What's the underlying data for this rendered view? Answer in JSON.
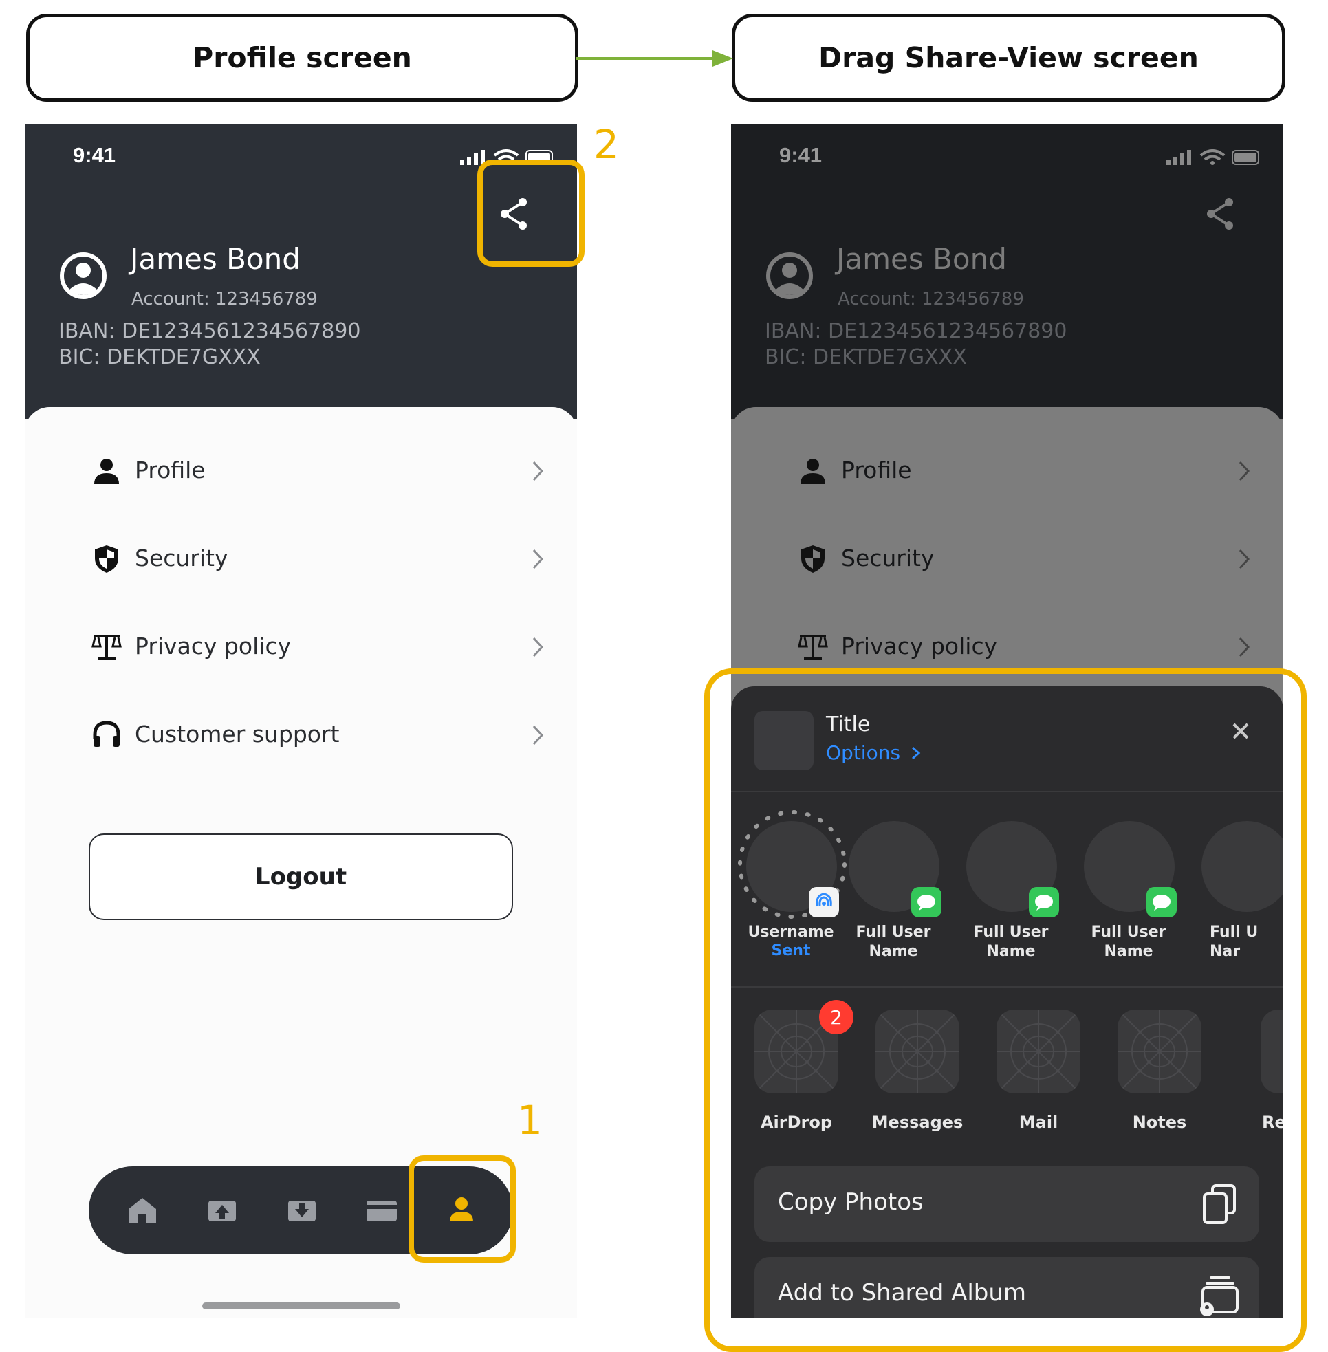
{
  "captions": {
    "left": "Profile screen",
    "right": "Drag Share-View screen"
  },
  "steps": {
    "one": "1",
    "two": "2"
  },
  "status": {
    "time": "9:41"
  },
  "user": {
    "name": "James Bond",
    "account": "Account: 123456789",
    "iban": "IBAN: DE1234561234567890",
    "bic": "BIC: DEKTDE7GXXX"
  },
  "menu": [
    {
      "label": "Profile",
      "icon": "person-icon"
    },
    {
      "label": "Security",
      "icon": "shield-icon"
    },
    {
      "label": "Privacy policy",
      "icon": "scales-icon"
    },
    {
      "label": "Customer support",
      "icon": "headset-icon"
    }
  ],
  "logout_label": "Logout",
  "tabbar": {
    "tabs": [
      "home-icon",
      "upload-icon",
      "download-icon",
      "card-icon",
      "person-icon"
    ],
    "active": "person-icon"
  },
  "share_sheet": {
    "title": "Title",
    "options": "Options",
    "people": [
      {
        "name": "Username",
        "sub": "Sent",
        "badge": "airdrop-badge-icon"
      },
      {
        "name": "Full User\nName",
        "badge": "messages-badge-icon"
      },
      {
        "name": "Full User\nName",
        "badge": "messages-badge-icon"
      },
      {
        "name": "Full User\nName",
        "badge": "messages-badge-icon"
      },
      {
        "name": "Full U\nNar",
        "badge": ""
      }
    ],
    "apps": [
      {
        "label": "AirDrop",
        "badge": "2"
      },
      {
        "label": "Messages"
      },
      {
        "label": "Mail"
      },
      {
        "label": "Notes"
      },
      {
        "label": "Re"
      }
    ],
    "actions": [
      {
        "label": "Copy Photos",
        "icon": "copy-icon"
      },
      {
        "label": "Add to Shared Album",
        "icon": "shared-album-icon"
      }
    ]
  },
  "colors": {
    "header_dark": "#2c3037",
    "highlight": "#f0b400",
    "arrow": "#7fb23a",
    "link_blue": "#2f8cff"
  }
}
